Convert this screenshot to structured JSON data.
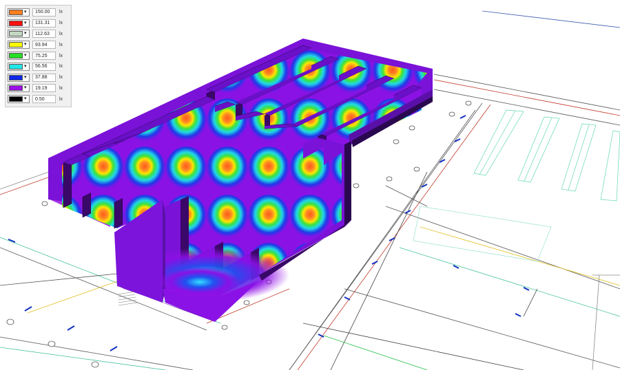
{
  "legend": {
    "unit": "lx",
    "levels": [
      {
        "color": "#ff7f1e",
        "value": "150.00"
      },
      {
        "color": "#ff1010",
        "value": "131.31"
      },
      {
        "color": "#c2d8c2",
        "value": "112.63"
      },
      {
        "color": "#ffff00",
        "value": "93.94"
      },
      {
        "color": "#22e022",
        "value": "75.25"
      },
      {
        "color": "#22e6e6",
        "value": "56.56"
      },
      {
        "color": "#1028e6",
        "value": "37.88"
      },
      {
        "color": "#9a10e6",
        "value": "19.19"
      },
      {
        "color": "#000000",
        "value": "0.50"
      }
    ]
  }
}
